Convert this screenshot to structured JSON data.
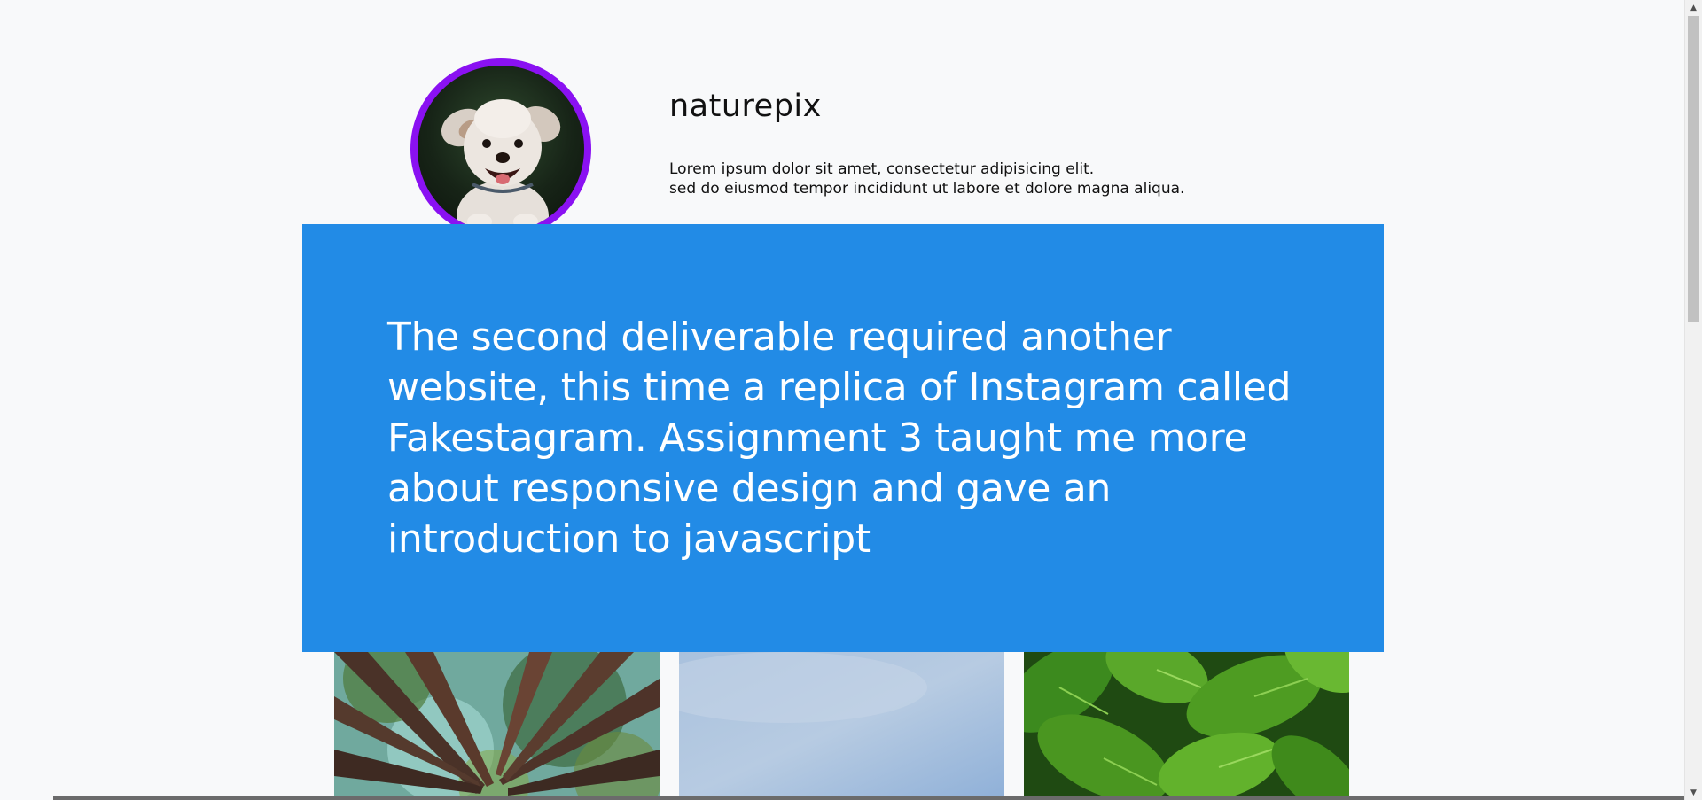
{
  "profile": {
    "username": "naturepix",
    "bio_line_1": "Lorem ipsum dolor sit amet, consectetur adipisicing elit.",
    "bio_line_2": "sed do eiusmod tempor incididunt ut labore et dolore magna aliqua.",
    "avatar_ring_color": "#8a11f2"
  },
  "overlay": {
    "text": "The second deliverable required another website, this time a replica of Instagram called Fakestagram. Assignment 3 taught me more about responsive design and gave an introduction to javascript",
    "background_color": "#228be6"
  },
  "gallery": {
    "photos": [
      {
        "subject": "forest-canopy"
      },
      {
        "subject": "sky"
      },
      {
        "subject": "green-leaves"
      }
    ]
  },
  "scrollbar": {
    "up_arrow": "▲",
    "down_arrow": "▼"
  }
}
